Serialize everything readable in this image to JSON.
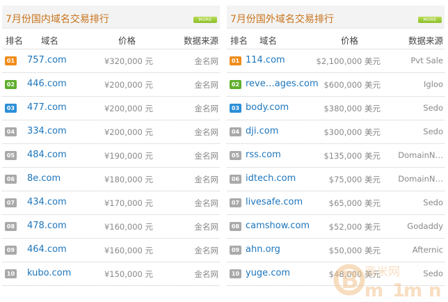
{
  "left": {
    "title": "7月份国内域名交易排行",
    "more_label": "MORE",
    "columns": {
      "rank": "排名",
      "domain": "域名",
      "price": "价格",
      "source": "数据来源"
    },
    "rows": [
      {
        "rank": "01",
        "domain": "757.com",
        "price": "¥320,000 元",
        "source": "金名网"
      },
      {
        "rank": "02",
        "domain": "446.com",
        "price": "¥200,000 元",
        "source": "金名网"
      },
      {
        "rank": "03",
        "domain": "477.com",
        "price": "¥200,000 元",
        "source": "金名网"
      },
      {
        "rank": "04",
        "domain": "334.com",
        "price": "¥200,000 元",
        "source": "金名网"
      },
      {
        "rank": "05",
        "domain": "484.com",
        "price": "¥190,000 元",
        "source": "金名网"
      },
      {
        "rank": "06",
        "domain": "8e.com",
        "price": "¥180,000 元",
        "source": "金名网"
      },
      {
        "rank": "07",
        "domain": "434.com",
        "price": "¥170,000 元",
        "source": "金名网"
      },
      {
        "rank": "08",
        "domain": "478.com",
        "price": "¥160,000 元",
        "source": "金名网"
      },
      {
        "rank": "09",
        "domain": "464.com",
        "price": "¥160,000 元",
        "source": "金名网"
      },
      {
        "rank": "10",
        "domain": "kubo.com",
        "price": "¥150,000 元",
        "source": "金名网"
      }
    ]
  },
  "right": {
    "title": "7月份国外域名交易排行",
    "more_label": "MORE",
    "columns": {
      "rank": "排名",
      "domain": "域名",
      "price": "价格",
      "source": "数据来源"
    },
    "rows": [
      {
        "rank": "01",
        "domain": "114.com",
        "price": "$2,100,000 美元",
        "source": "Pvt Sale"
      },
      {
        "rank": "02",
        "domain": "reve…ages.com",
        "price": "$600,000 美元",
        "source": "Igloo"
      },
      {
        "rank": "03",
        "domain": "body.com",
        "price": "$380,000 美元",
        "source": "Sedo"
      },
      {
        "rank": "04",
        "domain": "dji.com",
        "price": "$300,000 美元",
        "source": "Sedo"
      },
      {
        "rank": "05",
        "domain": "rss.com",
        "price": "$135,000 美元",
        "source": "DomainN…"
      },
      {
        "rank": "06",
        "domain": "idtech.com",
        "price": "$75,000 美元",
        "source": "DomainN…"
      },
      {
        "rank": "07",
        "domain": "livesafe.com",
        "price": "$65,000 美元",
        "source": "Sedo"
      },
      {
        "rank": "08",
        "domain": "camshow.com",
        "price": "$52,000 美元",
        "source": "Godaddy"
      },
      {
        "rank": "09",
        "domain": "ahn.org",
        "price": "$50,000 美元",
        "source": "Afternic"
      },
      {
        "rank": "10",
        "domain": "yuge.com",
        "price": "$48,000 美元",
        "source": "Sedo"
      }
    ]
  },
  "watermark": {
    "text": "商米网"
  },
  "colors": {
    "title": "#c8741c",
    "link": "#1c75bc",
    "muted": "#888888",
    "badge_first": "#f08c1a",
    "badge_second": "#5fae2e",
    "badge_third": "#2c8fd6",
    "badge_rest": "#a9a9a9",
    "more_button": "#8bbf2a"
  }
}
